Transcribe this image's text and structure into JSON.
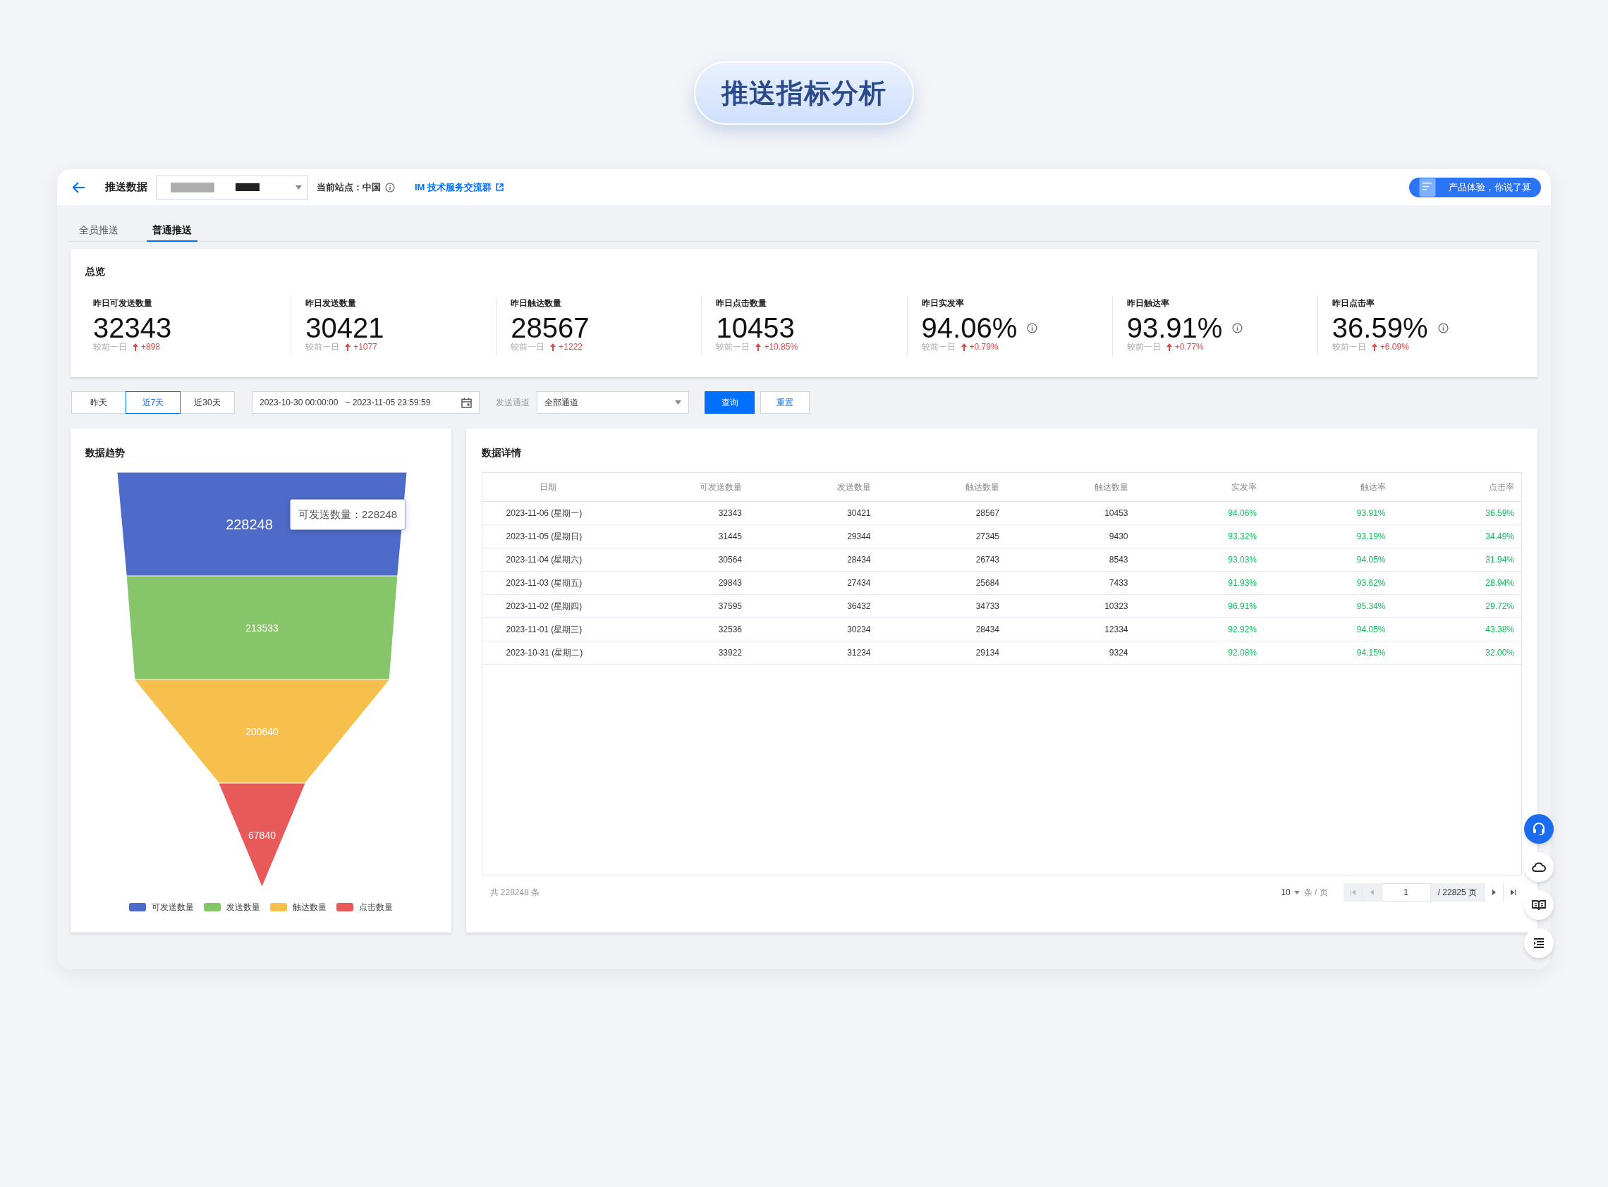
{
  "page_title": "推送指标分析",
  "header": {
    "title": "推送数据",
    "site_label": "当前站点：中国",
    "link": "IM 技术服务交流群",
    "feedback_button": "产品体验，你说了算"
  },
  "tabs": [
    {
      "label": "全员推送",
      "selected": false
    },
    {
      "label": "普通推送",
      "selected": true
    }
  ],
  "overview": {
    "title": "总览",
    "stats": [
      {
        "label": "昨日可发送数量",
        "value": "32343",
        "compare_label": "较前一日",
        "change": "+898",
        "kind": "count"
      },
      {
        "label": "昨日发送数量",
        "value": "30421",
        "compare_label": "较前一日",
        "change": "+1077",
        "kind": "count"
      },
      {
        "label": "昨日触达数量",
        "value": "28567",
        "compare_label": "较前一日",
        "change": "+1222",
        "kind": "count"
      },
      {
        "label": "昨日点击数量",
        "value": "10453",
        "compare_label": "较前一日",
        "change": "+10.85%",
        "kind": "count"
      },
      {
        "label": "昨日实发率",
        "value": "94.06%",
        "compare_label": "较前一日",
        "change": "+0.79%",
        "kind": "rate"
      },
      {
        "label": "昨日触达率",
        "value": "93.91%",
        "compare_label": "较前一日",
        "change": "+0.77%",
        "kind": "rate"
      },
      {
        "label": "昨日点击率",
        "value": "36.59%",
        "compare_label": "较前一日",
        "change": "+6.09%",
        "kind": "rate"
      }
    ]
  },
  "filters": {
    "ranges": [
      {
        "label": "昨天",
        "selected": false
      },
      {
        "label": "近7天",
        "selected": true
      },
      {
        "label": "近30天",
        "selected": false
      }
    ],
    "date_start": "2023-10-30 00:00:00",
    "date_end": "~ 2023-11-05 23:59:59",
    "channel_label": "发送通道",
    "channel_value": "全部通道",
    "query_button": "查询",
    "reset_button": "重置"
  },
  "trend": {
    "title": "数据趋势",
    "tooltip": "可发送数量：228248",
    "stages": [
      {
        "name": "可发送数量",
        "value": "228248",
        "color": "#4e6bc9",
        "highlighted": true
      },
      {
        "name": "发送数量",
        "value": "213533",
        "color": "#86c56a",
        "highlighted": false
      },
      {
        "name": "触达数量",
        "value": "200640",
        "color": "#f7c04c",
        "highlighted": false
      },
      {
        "name": "点击数量",
        "value": "67840",
        "color": "#e85a5a",
        "highlighted": false
      }
    ]
  },
  "details": {
    "title": "数据详情",
    "columns": [
      {
        "label": "日期",
        "kind": "date"
      },
      {
        "label": "可发送数量",
        "kind": "number"
      },
      {
        "label": "发送数量",
        "kind": "number"
      },
      {
        "label": "触达数量",
        "kind": "number"
      },
      {
        "label": "触达数量",
        "kind": "number"
      },
      {
        "label": "实发率",
        "kind": "rate"
      },
      {
        "label": "触达率",
        "kind": "rate"
      },
      {
        "label": "点击率",
        "kind": "rate"
      }
    ],
    "rows": [
      [
        "2023-11-06 (星期一)",
        "32343",
        "30421",
        "28567",
        "10453",
        "94.06%",
        "93.91%",
        "36.59%"
      ],
      [
        "2023-11-05 (星期日)",
        "31445",
        "29344",
        "27345",
        "9430",
        "93.32%",
        "93.19%",
        "34.49%"
      ],
      [
        "2023-11-04 (星期六)",
        "30564",
        "28434",
        "26743",
        "8543",
        "93.03%",
        "94.05%",
        "31.94%"
      ],
      [
        "2023-11-03 (星期五)",
        "29843",
        "27434",
        "25684",
        "7433",
        "91.93%",
        "93.62%",
        "28.94%"
      ],
      [
        "2023-11-02 (星期四)",
        "37595",
        "36432",
        "34733",
        "10323",
        "96.91%",
        "95.34%",
        "29.72%"
      ],
      [
        "2023-11-01 (星期三)",
        "32536",
        "30234",
        "28434",
        "12334",
        "92.92%",
        "94.05%",
        "43.38%"
      ],
      [
        "2023-10-31 (星期二)",
        "33922",
        "31234",
        "29134",
        "9324",
        "92.08%",
        "94.15%",
        "32.00%"
      ]
    ],
    "total": "共 228248 条",
    "page_size": "10",
    "page_size_unit": "条 / 页",
    "page": "1",
    "page_count": "/ 22825 页"
  }
}
